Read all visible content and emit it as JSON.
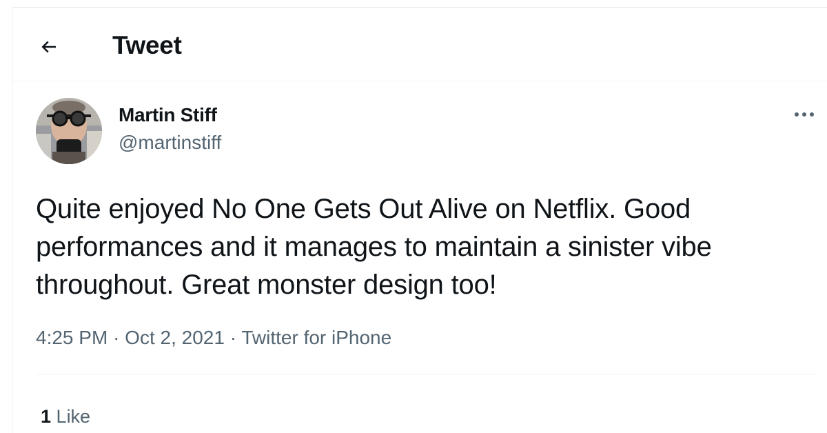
{
  "header": {
    "back_icon": "arrow-left-icon",
    "title": "Tweet"
  },
  "tweet": {
    "author": {
      "name": "Martin Stiff",
      "handle": "@martinstiff"
    },
    "more_icon": "more-horizontal-icon",
    "text": "Quite enjoyed No One Gets Out Alive on Netflix. Good performances and it manages to maintain a sinister vibe throughout. Great monster design too!",
    "time": "4:25 PM",
    "date": "Oct 2, 2021",
    "source": "Twitter for iPhone",
    "separator": "·",
    "likes": {
      "count": "1",
      "label": "Like"
    }
  },
  "colors": {
    "primary_text": "#0f1419",
    "secondary_text": "#536471",
    "border": "#eff3f4"
  }
}
